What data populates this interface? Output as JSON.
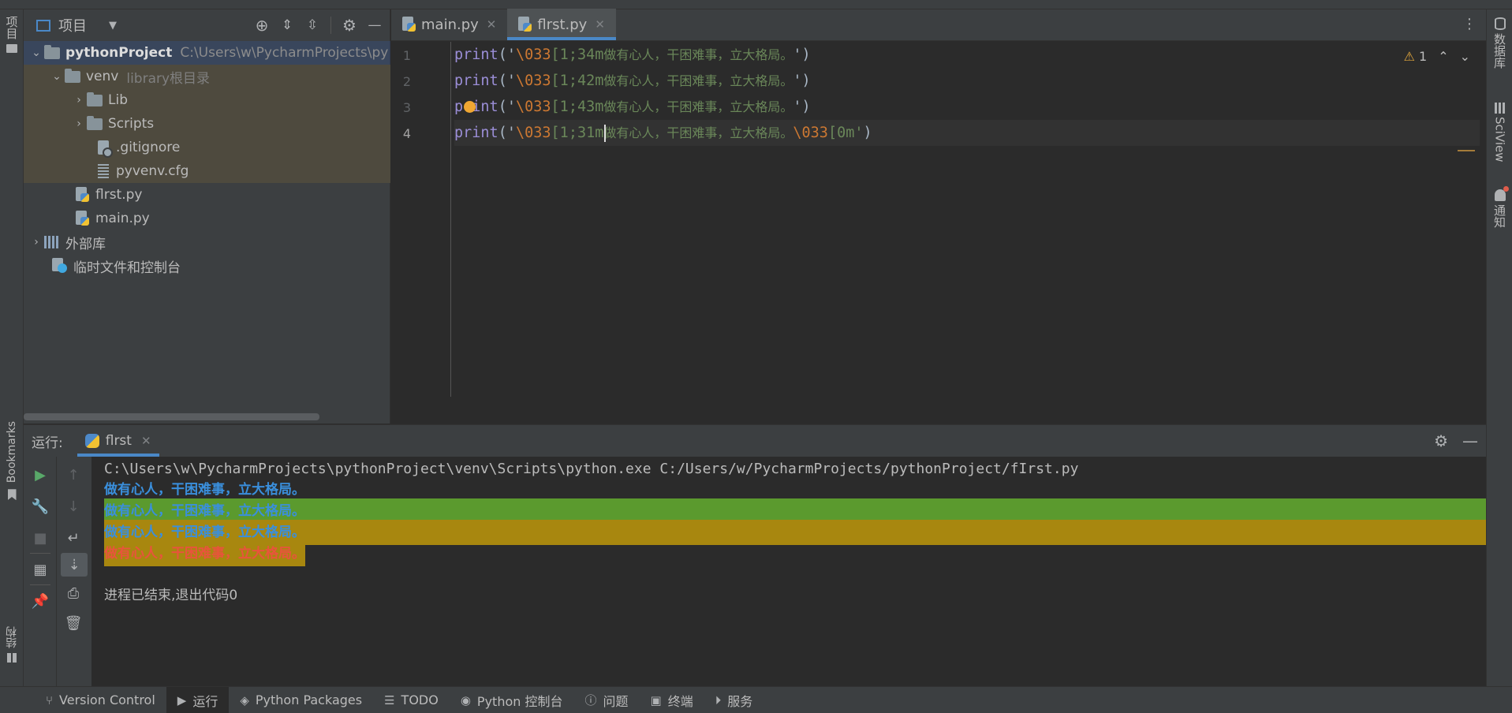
{
  "left_strip": {
    "project": "项目",
    "bookmarks": "Bookmarks",
    "structure": "结构"
  },
  "right_strip": {
    "database": "数据库",
    "sciview": "SciView",
    "notifications": "通知"
  },
  "project_panel": {
    "title": "项目",
    "tree": [
      {
        "label": "pythonProject",
        "path": "C:\\Users\\w\\PycharmProjects\\py"
      },
      {
        "label": "venv",
        "hint": "library根目录"
      },
      {
        "label": "Lib"
      },
      {
        "label": "Scripts"
      },
      {
        "label": ".gitignore"
      },
      {
        "label": "pyvenv.cfg"
      },
      {
        "label": "flrst.py"
      },
      {
        "label": "main.py"
      },
      {
        "label": "外部库"
      },
      {
        "label": "临时文件和控制台"
      }
    ]
  },
  "editor": {
    "tabs": [
      {
        "label": "main.py"
      },
      {
        "label": "flrst.py"
      }
    ],
    "line_numbers": [
      "1",
      "2",
      "3",
      "4"
    ],
    "lines": [
      {
        "kw": "print",
        "open": "('",
        "esc": "\\033",
        "code": "[1;34m",
        "text": "做有心人，干困难事，立大格局。",
        "close": "')"
      },
      {
        "kw": "print",
        "open": "('",
        "esc": "\\033",
        "code": "[1;42m",
        "text": "做有心人，干困难事，立大格局。",
        "close": "')"
      },
      {
        "kw": "print",
        "open": "('",
        "esc": "\\033",
        "code": "[1;43m",
        "text": "做有心人，干困难事，立大格局。",
        "close": "')"
      },
      {
        "kw": "print",
        "open": "('",
        "esc": "\\033",
        "code": "[1;31m",
        "text": "做有心人，干困难事，立大格局。",
        "esc2": "\\033",
        "code2": "[0m'",
        "close": ")"
      }
    ],
    "warnings_count": "1"
  },
  "run_panel": {
    "label": "运行:",
    "tab": "flrst",
    "command": "C:\\Users\\w\\PycharmProjects\\pythonProject\\venv\\Scripts\\python.exe C:/Users/w/PycharmProjects/pythonProject/fIrst.py",
    "outputs": [
      "做有心人，干困难事，立大格局。",
      "做有心人，干困难事，立大格局。",
      "做有心人，干困难事，立大格局。",
      "做有心人，干困难事，立大格局。"
    ],
    "exit_message": "进程已结束,退出代码0"
  },
  "statusbar": {
    "items": [
      {
        "label": "Version Control"
      },
      {
        "label": "运行"
      },
      {
        "label": "Python Packages"
      },
      {
        "label": "TODO"
      },
      {
        "label": "Python 控制台"
      },
      {
        "label": "问题"
      },
      {
        "label": "终端"
      },
      {
        "label": "服务"
      }
    ]
  },
  "colors": {
    "ansi_blue": "#3a8fdc",
    "ansi_green_bg": "#5b9a2e",
    "ansi_yellow_bg": "#a8870f",
    "ansi_red": "#e8543c",
    "accent": "#4a88c7"
  }
}
